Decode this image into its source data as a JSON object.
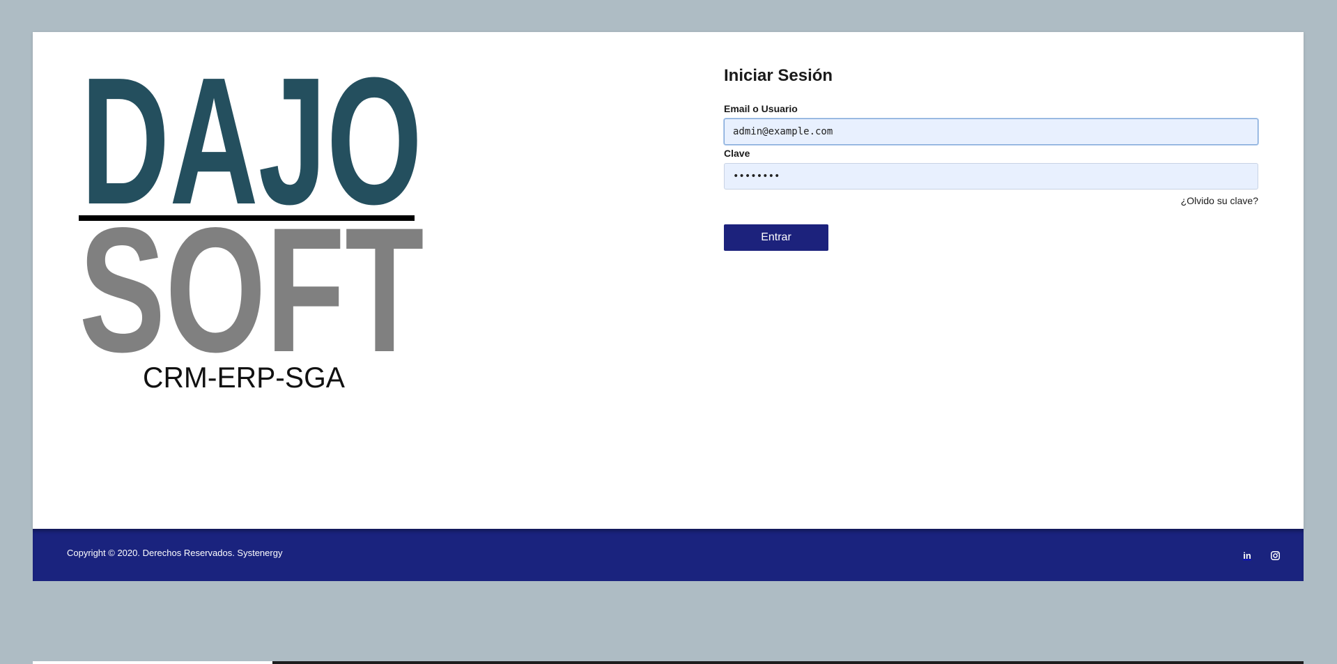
{
  "logo": {
    "line1": "DAJO",
    "line2": "SOFT",
    "tagline": "CRM-ERP-SGA",
    "color_primary": "#244f5e",
    "color_secondary": "#808080"
  },
  "login": {
    "title": "Iniciar Sesión",
    "email_label": "Email o Usuario",
    "email_value": "admin@example.com",
    "password_label": "Clave",
    "password_value": "••••••••",
    "forgot_link": "¿Olvido su clave?",
    "submit_label": "Entrar"
  },
  "footer": {
    "copyright": "Copyright © 2020. Derechos Reservados. Systenergy",
    "social": [
      {
        "icon": "linkedin-icon",
        "label": "in"
      },
      {
        "icon": "instagram-icon"
      }
    ]
  },
  "colors": {
    "page_bg": "#aebcc4",
    "accent": "#1a237e",
    "input_bg": "#e8f0fe"
  }
}
